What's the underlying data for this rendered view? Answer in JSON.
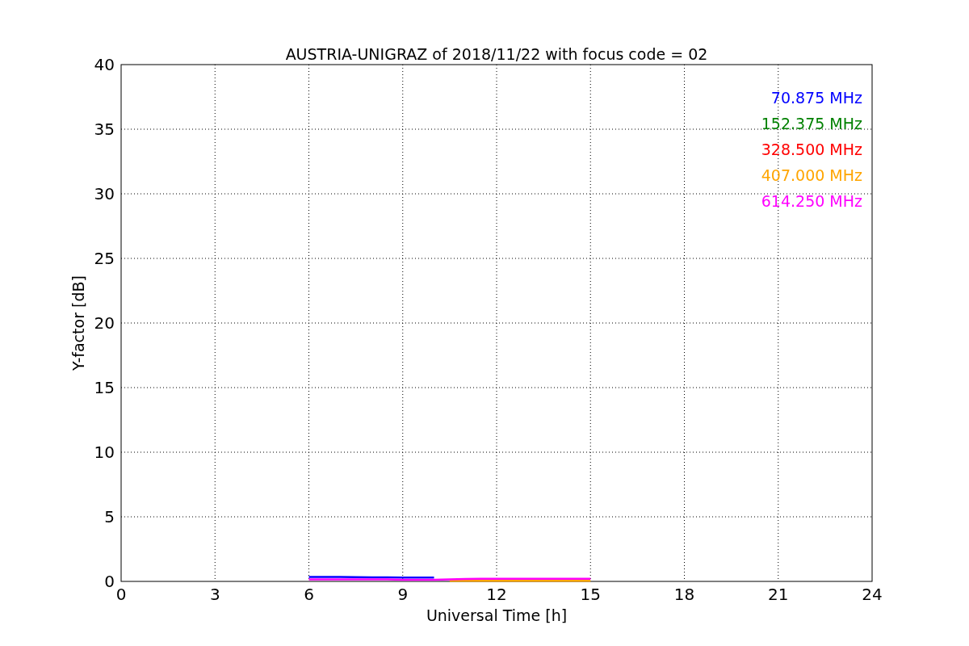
{
  "chart_data": {
    "type": "line",
    "title": "AUSTRIA-UNIGRAZ of 2018/11/22 with focus code = 02",
    "xlabel": "Universal Time [h]",
    "ylabel": "Y-factor [dB]",
    "grid": true,
    "x": [
      6,
      6.5,
      7,
      7.5,
      8,
      8.5,
      9,
      9.5,
      10,
      10.5,
      11,
      11.5,
      12,
      12.5,
      13,
      13.5,
      14,
      14.5,
      15
    ],
    "series": [
      {
        "name": "70.875 MHz",
        "color": "#0000ff",
        "values": [
          0.35,
          0.35,
          0.35,
          0.33,
          0.32,
          0.32,
          0.3,
          0.3,
          0.3,
          null,
          null,
          null,
          null,
          null,
          null,
          null,
          null,
          null,
          null
        ]
      },
      {
        "name": "152.375 MHz",
        "color": "#008000",
        "values": [
          null,
          null,
          null,
          null,
          null,
          null,
          null,
          null,
          null,
          null,
          null,
          null,
          null,
          null,
          null,
          null,
          null,
          null,
          null
        ]
      },
      {
        "name": "328.500 MHz",
        "color": "#ff0000",
        "values": [
          null,
          null,
          null,
          null,
          null,
          null,
          null,
          null,
          null,
          null,
          null,
          null,
          null,
          null,
          null,
          null,
          null,
          null,
          null
        ]
      },
      {
        "name": "407.000 MHz",
        "color": "#ffa500",
        "values": [
          null,
          null,
          null,
          null,
          null,
          null,
          null,
          null,
          null,
          0.05,
          0.05,
          0.05,
          0.05,
          0.05,
          0.05,
          0.05,
          0.05,
          0.05,
          0.05
        ]
      },
      {
        "name": "614.250 MHz",
        "color": "#ff00ff",
        "values": [
          0.15,
          0.15,
          0.15,
          0.15,
          0.15,
          0.15,
          0.12,
          0.12,
          0.12,
          0.15,
          0.18,
          0.2,
          0.2,
          0.2,
          0.2,
          0.2,
          0.2,
          0.2,
          0.2
        ]
      }
    ],
    "xlim": [
      0,
      24
    ],
    "ylim": [
      0,
      40
    ],
    "xticks": [
      0,
      3,
      6,
      9,
      12,
      15,
      18,
      21,
      24
    ],
    "yticks": [
      0,
      5,
      10,
      15,
      20,
      25,
      30,
      35,
      40
    ]
  }
}
